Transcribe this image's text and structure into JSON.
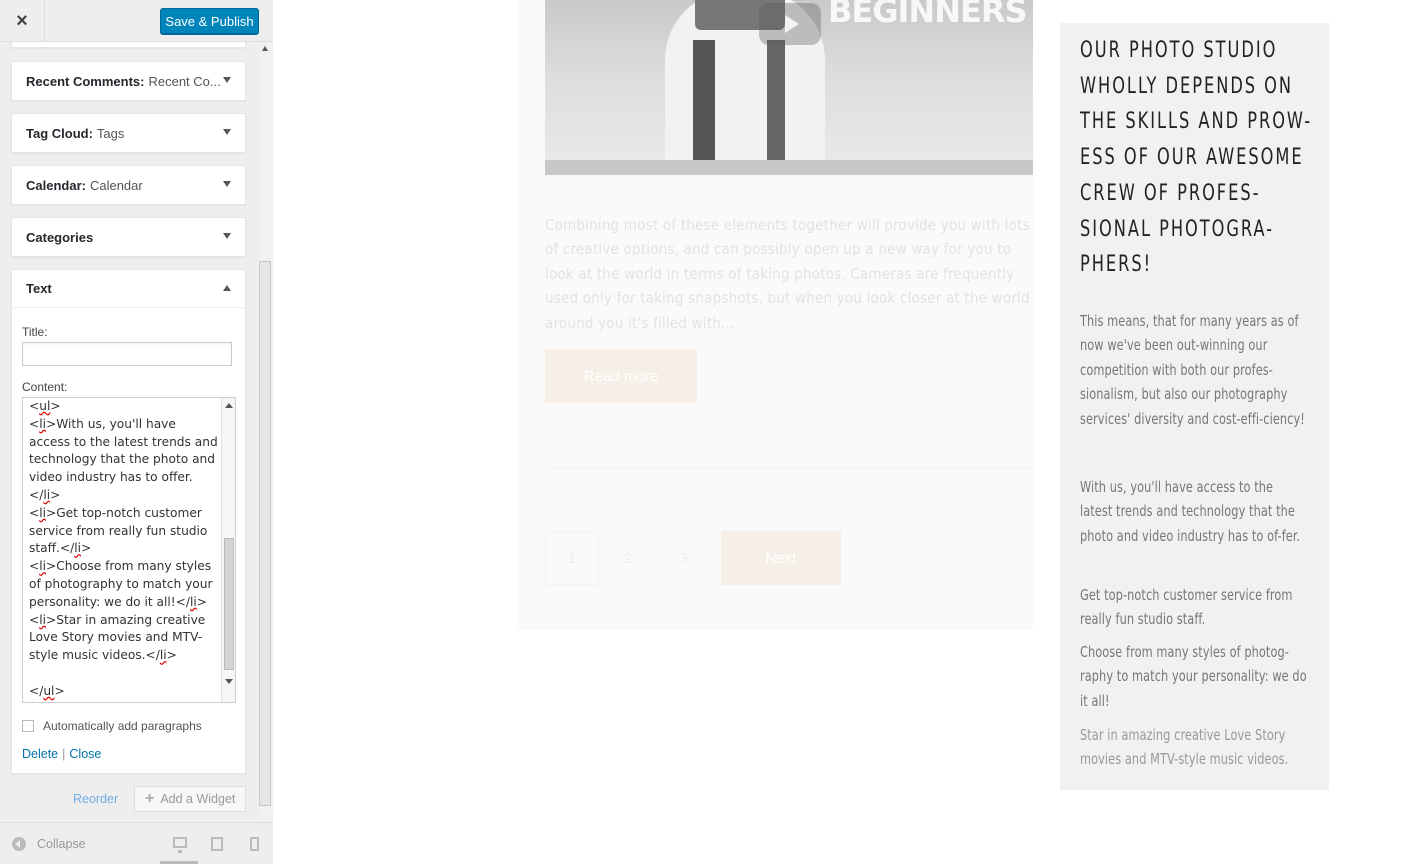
{
  "header": {
    "close_icon": "×",
    "save_label": "Save & Publish"
  },
  "widgets": [
    {
      "name": "Recent Comments:",
      "title": "Recent Co..."
    },
    {
      "name": "Tag Cloud:",
      "title": "Tags"
    },
    {
      "name": "Calendar:",
      "title": "Calendar"
    },
    {
      "name": "Categories",
      "title": ""
    }
  ],
  "text_widget": {
    "name": "Text",
    "title_label": "Title:",
    "title_value": "",
    "content_label": "Content:",
    "content_lines": [
      "<ul>",
      "<li>With us, you'll have access to the latest trends and technology that the photo and video industry has to offer.</li>",
      "<li>Get top-notch customer service from really fun studio staff.</li>",
      "<li>Choose from many styles of photography to match your personality: we do it all!</li>",
      "<li>Star in amazing creative Love Story movies and MTV-style music videos.</li>",
      "",
      "</ul>"
    ],
    "auto_paragraphs_label": "Automatically add paragraphs",
    "auto_paragraphs_checked": false,
    "delete_label": "Delete",
    "separator": "|",
    "close_label": "Close"
  },
  "actions": {
    "reorder_label": "Reorder",
    "add_widget_label": "Add a Widget"
  },
  "footer": {
    "collapse_label": "Collapse",
    "active_device": "desktop"
  },
  "preview": {
    "video_word": "BEGINNERS",
    "excerpt": "Combining most of these elements together will provide you with lots of creative options, and can possibly open up a new way for you to look at the world in terms of taking photos. Cameras are frequently used only for taking snapshots, but when you look closer at the world around you it's filled with…",
    "read_more_label": "Read more",
    "pagination": [
      "1",
      "2",
      "3"
    ],
    "next_label": "Next",
    "widget": {
      "title": "Our photo studio wholly depends on the skills and prow-ess of our awesome crew of profes-sional photogra-phers!",
      "para1": "This means, that for many years as of now we've been out-winning our competition with both our profes-sionalism, but also our photography services' diversity and cost-effi-ciency!",
      "para2": "With us, you'll have access to the latest trends and technology that the photo and video industry has to of-fer.",
      "items": [
        "Get top-notch customer service from really fun studio staff.",
        "Choose from many styles of photog-raphy to match your personality: we do it all!",
        "Star in amazing creative Love Story movies and MTV-style music videos."
      ]
    }
  },
  "colors": {
    "accent": "#0085ba",
    "link": "#0073aa",
    "button_light": "#f6efe8"
  }
}
